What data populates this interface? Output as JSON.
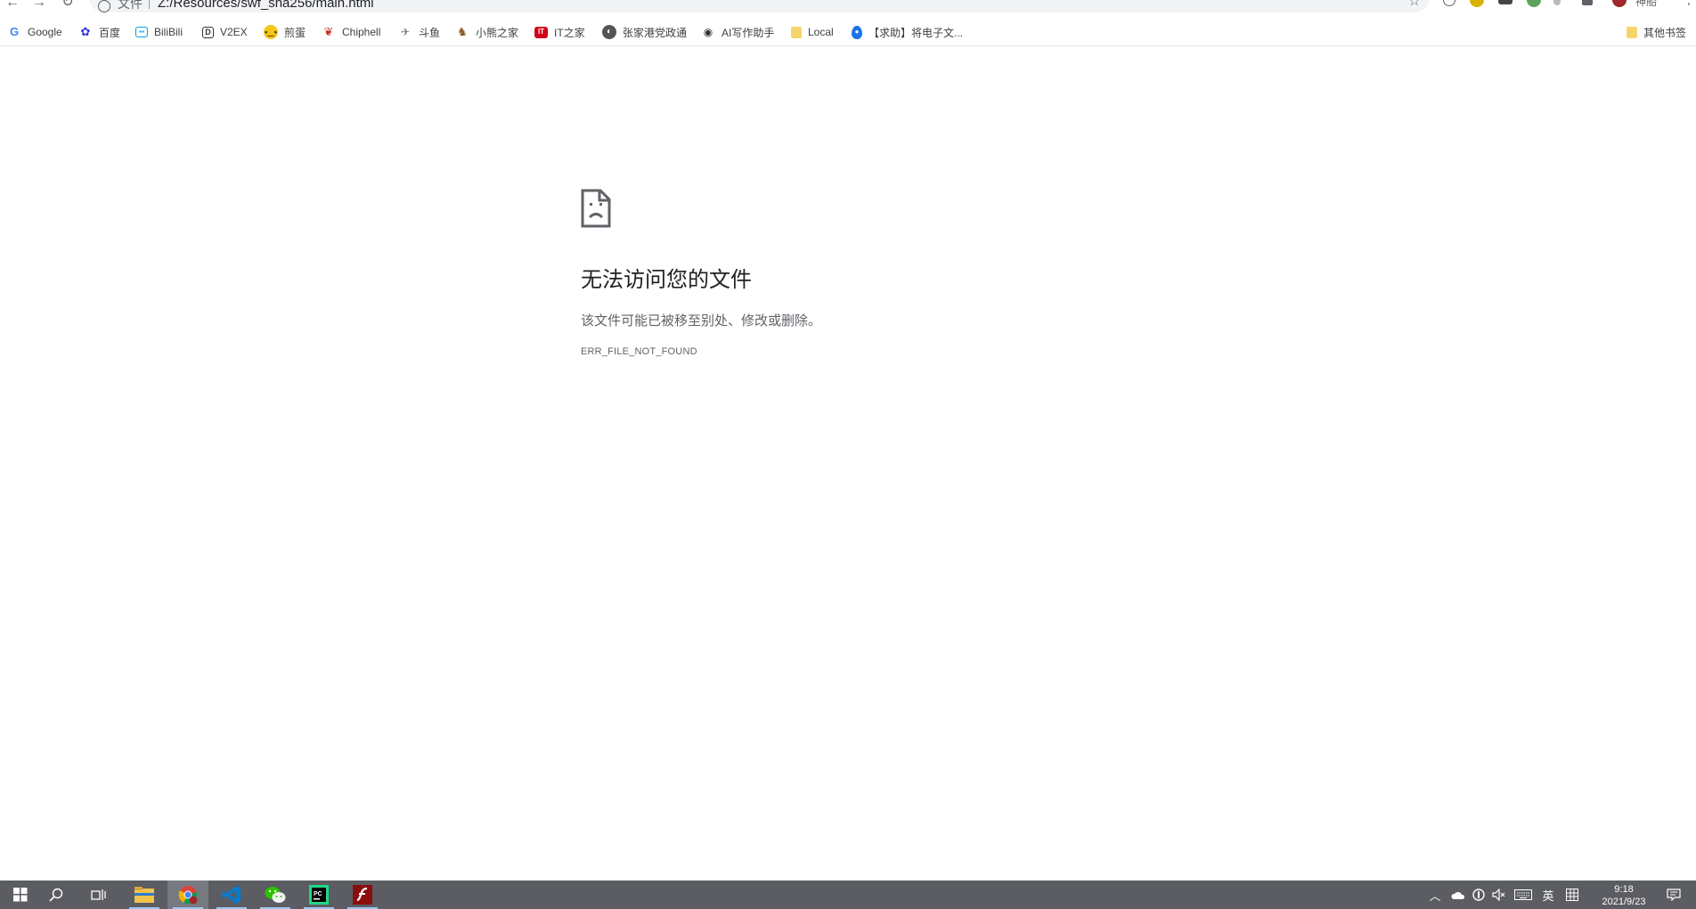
{
  "browser": {
    "omnibox": {
      "scheme_label": "文件",
      "url": "Z:/Resources/swf_sha256/main.html"
    },
    "profile_name": "神船"
  },
  "bookmarks": [
    {
      "label": "Google",
      "icon": "google-icon",
      "color": "#4285f4"
    },
    {
      "label": "百度",
      "icon": "baidu-icon",
      "color": "#2932e1"
    },
    {
      "label": "BiliBili",
      "icon": "bilibili-icon",
      "color": "#00a1d6"
    },
    {
      "label": "V2EX",
      "icon": "v2ex-icon",
      "color": "#333333"
    },
    {
      "label": "煎蛋",
      "icon": "jandan-icon",
      "color": "#f5c518"
    },
    {
      "label": "Chiphell",
      "icon": "chiphell-icon",
      "color": "#c0392b"
    },
    {
      "label": "斗鱼",
      "icon": "douyu-icon",
      "color": "#8a8a8a"
    },
    {
      "label": "小熊之家",
      "icon": "bear-icon",
      "color": "#8b5a2b"
    },
    {
      "label": "IT之家",
      "icon": "ithome-icon",
      "color": "#d0021b"
    },
    {
      "label": "张家港党政通",
      "icon": "globe-icon",
      "color": "#555555"
    },
    {
      "label": "AI写作助手",
      "icon": "ai-writer-icon",
      "color": "#444444"
    },
    {
      "label": "Local",
      "icon": "folder-icon",
      "color": "#f6d46b"
    },
    {
      "label": "【求助】将电子文...",
      "icon": "drop-icon",
      "color": "#1a73e8"
    }
  ],
  "other_bookmarks": {
    "label": "其他书签",
    "icon": "folder-icon"
  },
  "error": {
    "title": "无法访问您的文件",
    "description": "该文件可能已被移至别处、修改或删除。",
    "code": "ERR_FILE_NOT_FOUND"
  },
  "taskbar": {
    "apps": [
      "start",
      "search",
      "task-view",
      "file-explorer",
      "chrome",
      "vscode",
      "wechat",
      "pycharm",
      "flash"
    ],
    "ime_label": "英",
    "clock_time": "9:18",
    "clock_date": "2021/9/23"
  }
}
